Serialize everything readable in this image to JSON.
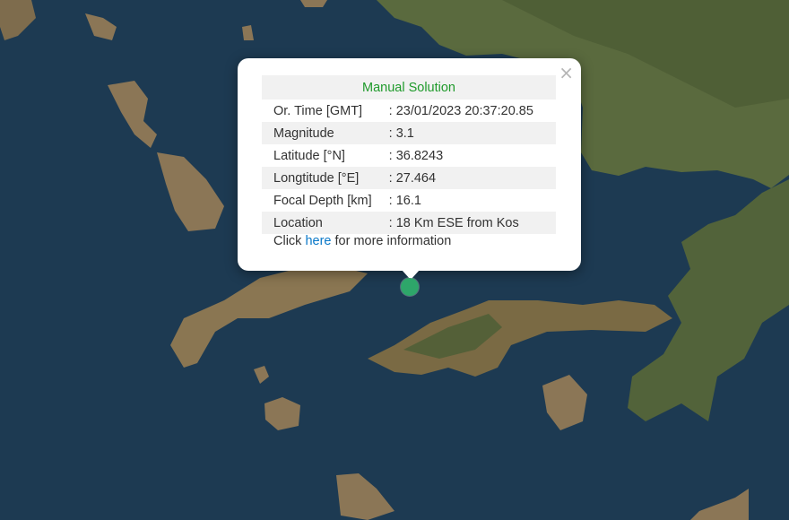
{
  "map": {
    "colors": {
      "sea": "#1d3a52",
      "land": "#7a6a4a",
      "vegetation": "#4a5e35"
    },
    "icons": [
      "close-icon",
      "epicenter-marker"
    ]
  },
  "popup": {
    "title": "Manual Solution",
    "close_label": "×",
    "rows": [
      {
        "label": "Or. Time [GMT]",
        "value": ": 23/01/2023 20:37:20.85"
      },
      {
        "label": "Magnitude",
        "value": ": 3.1"
      },
      {
        "label": "Latitude [°N]",
        "value": ": 36.8243"
      },
      {
        "label": "Longtitude [°E]",
        "value": ": 27.464"
      },
      {
        "label": "Focal Depth [km]",
        "value": ": 16.1"
      },
      {
        "label": "Location",
        "value": ": 18 Km ESE from Kos"
      }
    ],
    "more_info": {
      "prefix": "Click ",
      "link": "here",
      "suffix": " for more information"
    },
    "title_color": "#1f9a2b",
    "link_color": "#0a78c8"
  }
}
